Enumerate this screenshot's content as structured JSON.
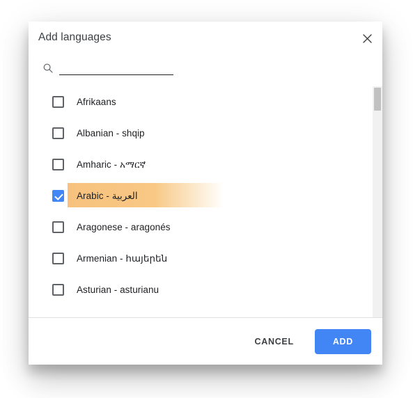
{
  "dialog": {
    "title": "Add languages",
    "close_icon": "close-icon"
  },
  "search": {
    "icon": "search-icon",
    "value": "",
    "placeholder": ""
  },
  "list": {
    "items": [
      {
        "label": "Afrikaans",
        "checked": false
      },
      {
        "label": "Albanian - shqip",
        "checked": false
      },
      {
        "label": "Amharic - አማርኛ",
        "checked": false
      },
      {
        "label": "Arabic - العربية",
        "checked": true
      },
      {
        "label": "Aragonese - aragonés",
        "checked": false
      },
      {
        "label": "Armenian - հայերեն",
        "checked": false
      },
      {
        "label": "Asturian - asturianu",
        "checked": false
      }
    ]
  },
  "scrollbar": {
    "name": "vertical-scrollbar"
  },
  "footer": {
    "cancel_label": "CANCEL",
    "add_label": "ADD"
  },
  "colors": {
    "accent": "#4285f4",
    "highlight": "#f7c27e",
    "text": "#202124",
    "scroll_thumb": "#c1c1c1"
  }
}
